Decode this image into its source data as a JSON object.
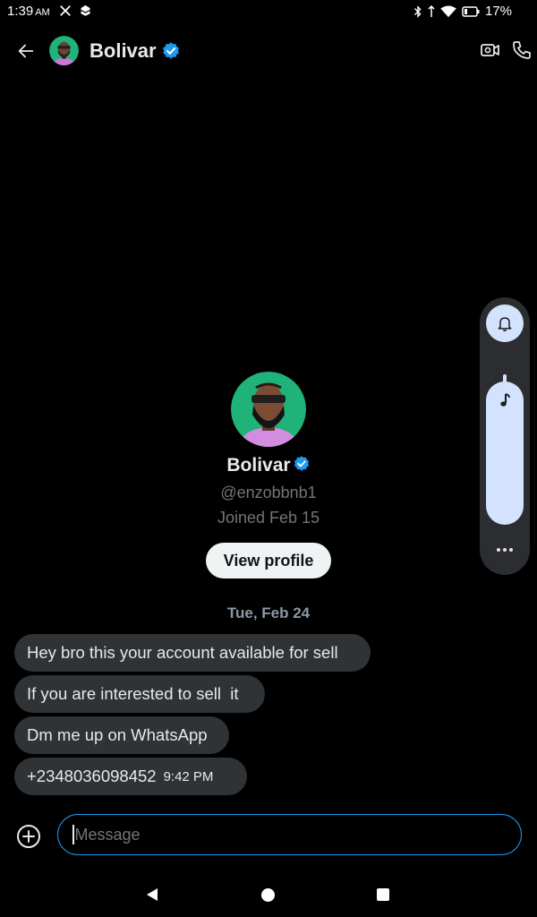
{
  "status_bar": {
    "time": "1:39",
    "ampm": "AM",
    "battery": "17%"
  },
  "header": {
    "name": "Bolivar"
  },
  "profile": {
    "name": "Bolivar",
    "handle": "@enzobbnb1",
    "joined": "Joined Feb 15",
    "view_profile_label": "View profile"
  },
  "conversation": {
    "date_separator": "Tue, Feb 24",
    "messages": [
      {
        "text": "Hey bro this your account available for sell"
      },
      {
        "text": "If you are interested to sell  it"
      },
      {
        "text": "Dm me up on WhatsApp"
      },
      {
        "text": "+2348036098452",
        "time": "9:42 PM"
      }
    ]
  },
  "composer": {
    "placeholder": "Message"
  },
  "colors": {
    "accent": "#1d9bf0",
    "bubble": "#2f3336",
    "background": "#000000",
    "volume_accent": "#d3e3fd"
  }
}
